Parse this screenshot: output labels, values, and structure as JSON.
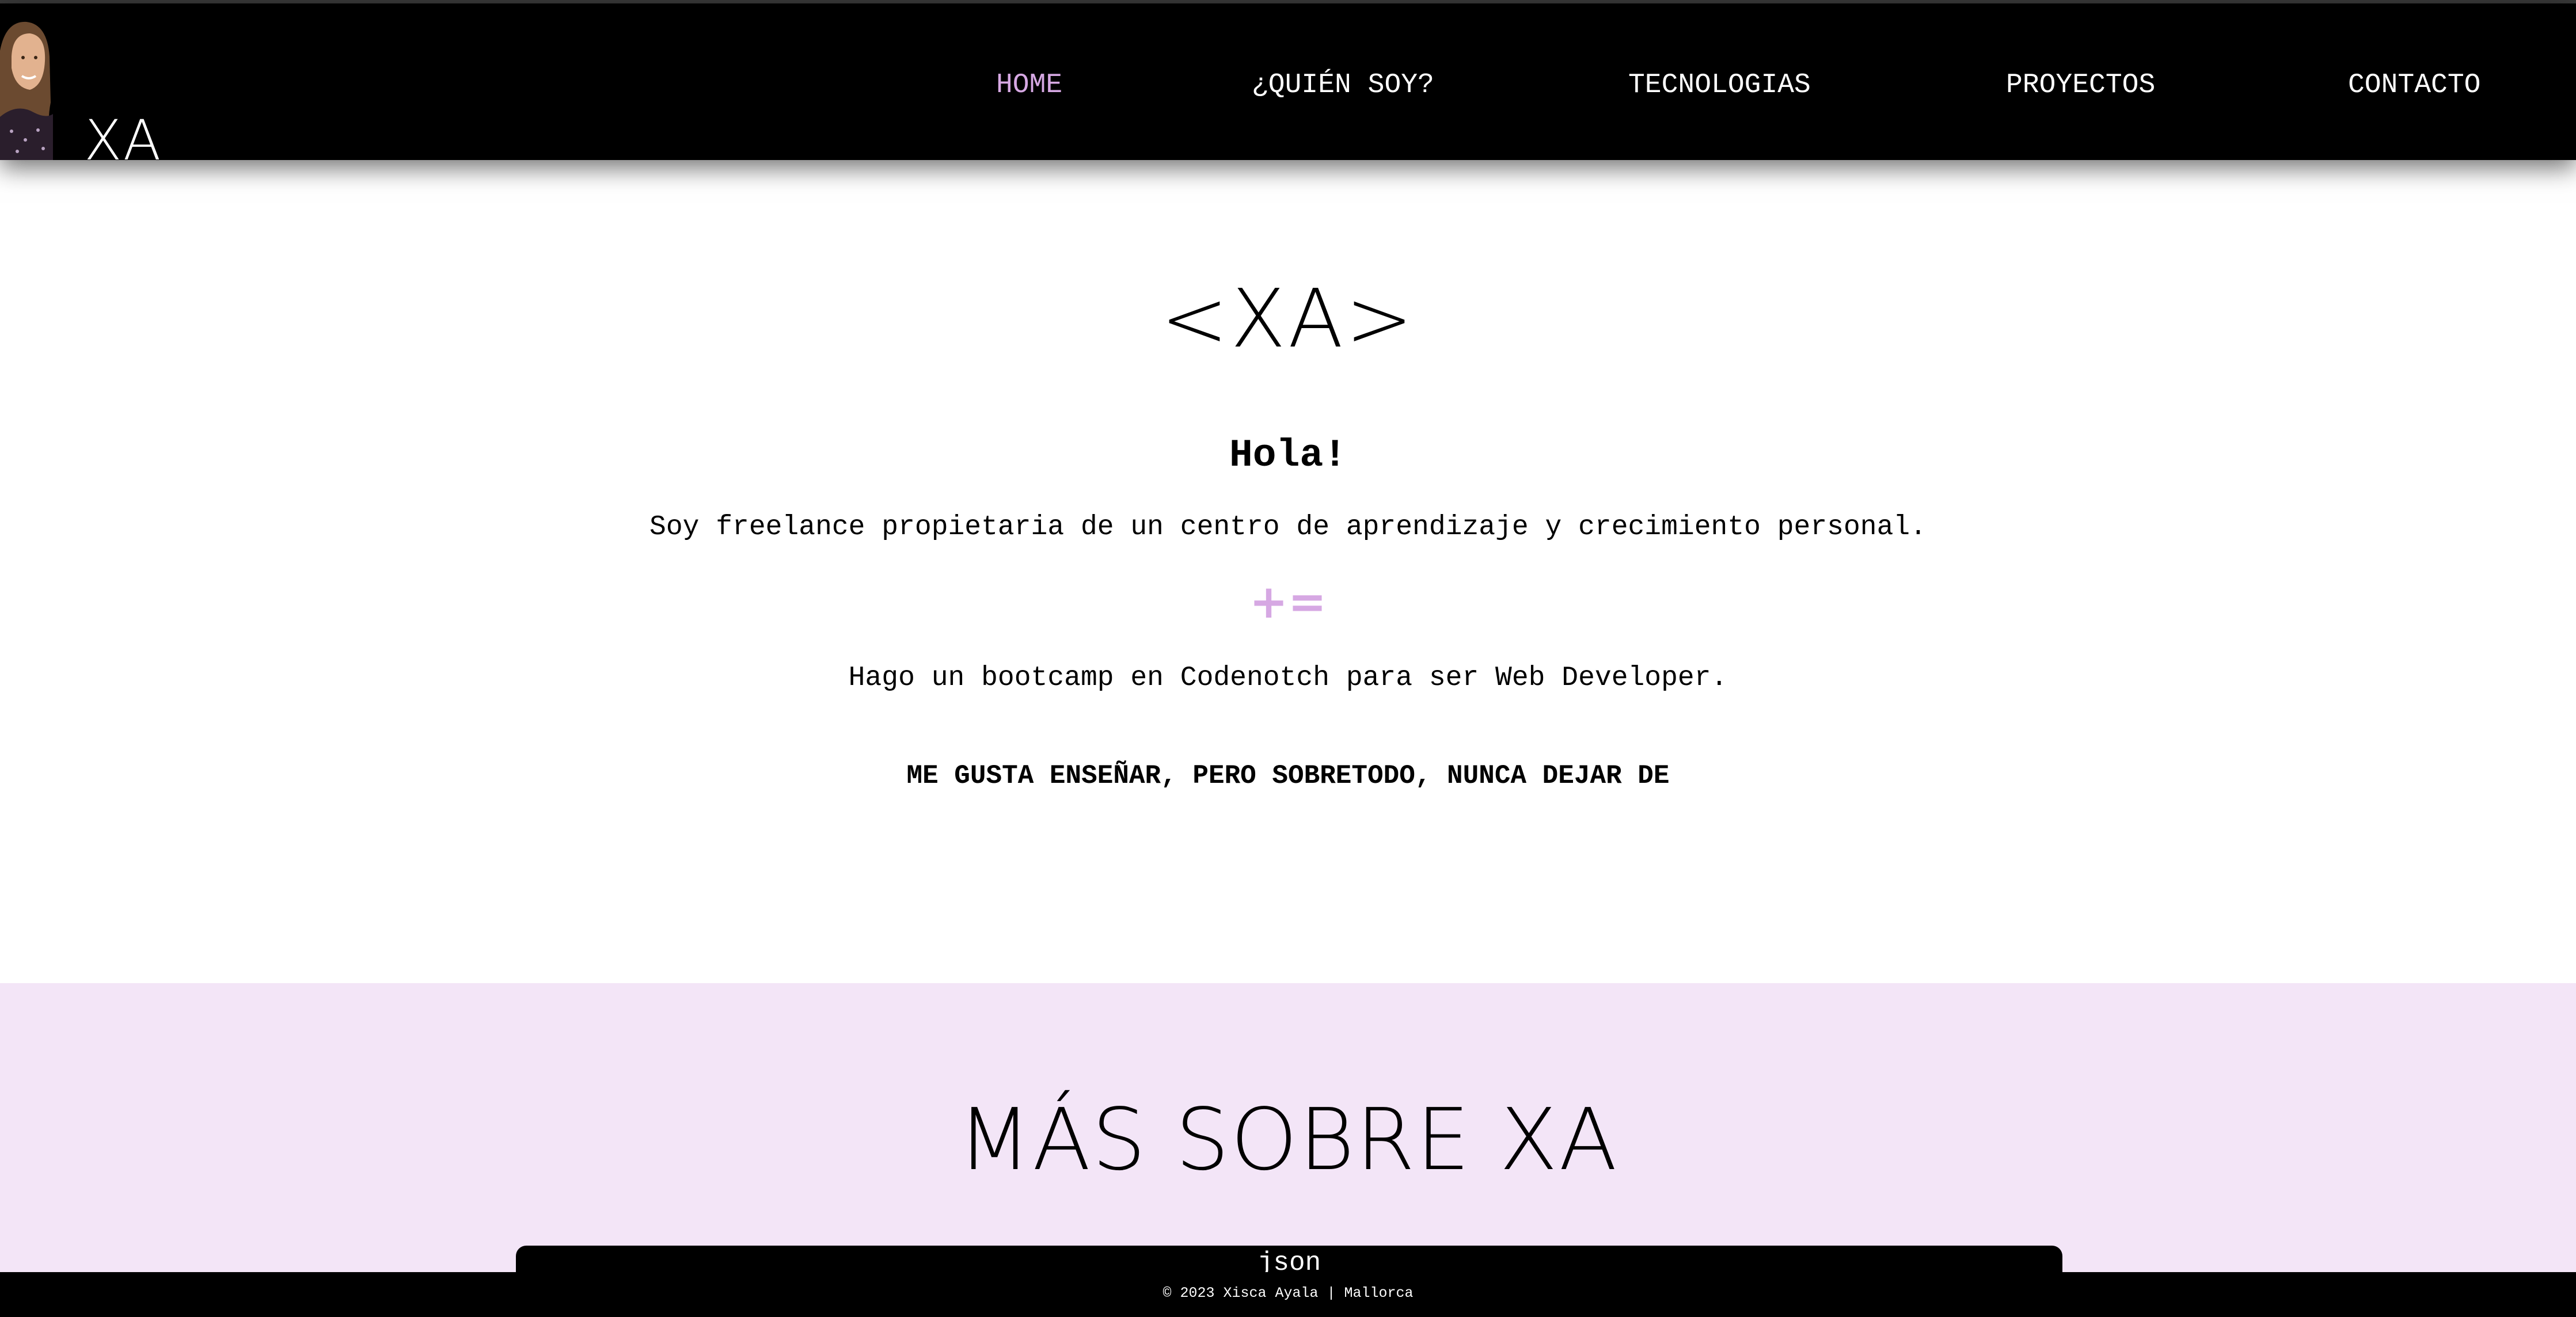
{
  "header": {
    "brand": "XA",
    "avatar": "profile-photo",
    "nav": [
      {
        "label": "HOME",
        "active": true
      },
      {
        "label": "¿QUIÉN SOY?",
        "active": false
      },
      {
        "label": "TECNOLOGIAS",
        "active": false
      },
      {
        "label": "PROYECTOS",
        "active": false
      },
      {
        "label": "CONTACTO",
        "active": false
      }
    ]
  },
  "hero": {
    "logo": "<XA>",
    "greeting": "Hola!",
    "intro": "Soy freelance propietaria de un centro de aprendizaje y crecimiento personal.",
    "operator": "+=",
    "bootcamp": "Hago un bootcamp en Codenotch para ser Web Developer.",
    "motto": "ME GUSTA ENSEÑAR, PERO SOBRETODO, NUNCA DEJAR DE"
  },
  "about": {
    "title": "MÁS SOBRE XA",
    "panel_label": "json"
  },
  "footer": {
    "text": "© 2023 Xisca Ayala | Mallorca"
  },
  "colors": {
    "accent": "#d6a8e3",
    "about_bg": "#f3e5f7",
    "navbar_bg": "#000000"
  }
}
